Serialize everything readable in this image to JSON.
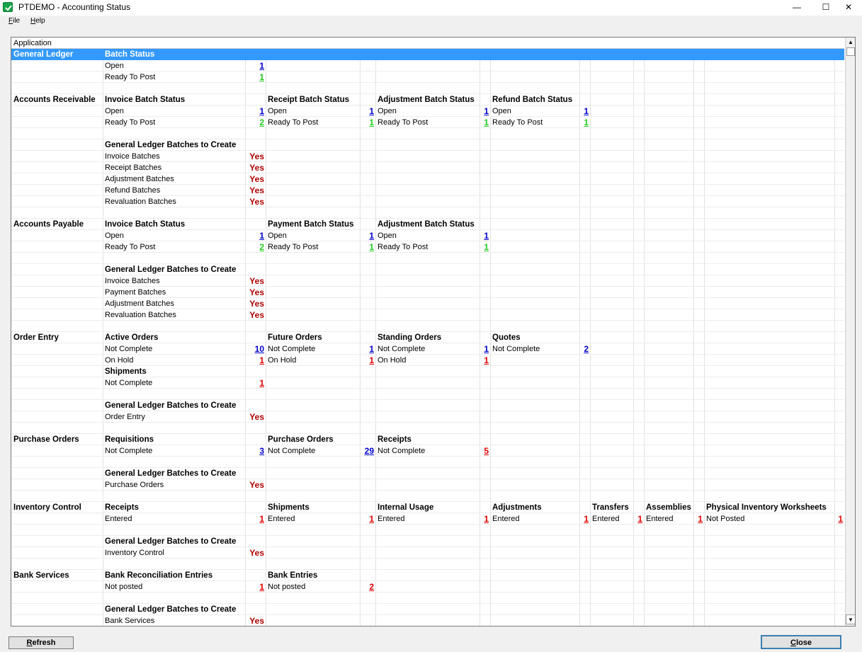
{
  "window": {
    "title": "PTDEMO - Accounting Status",
    "min": "—",
    "max": "☐",
    "close": "✕"
  },
  "menu": [
    {
      "first": "F",
      "rest": "ile"
    },
    {
      "first": "H",
      "rest": "elp"
    }
  ],
  "header": {
    "application": "Application"
  },
  "buttons": {
    "refresh_first": "R",
    "refresh_rest": "efresh",
    "close_first": "C",
    "close_rest": "lose"
  },
  "colors": {
    "selected": "#3399ff",
    "open": "#0000cc",
    "ready": "#22cc22",
    "alert": "#e00000",
    "yes": "#b00000"
  },
  "rows": [
    [
      {
        "c": 0,
        "t": "General Ledger",
        "k": "app"
      },
      {
        "c": 1,
        "t": "Batch Status",
        "k": "hdr"
      }
    ],
    [
      {
        "c": 1,
        "t": "Open",
        "k": "lbl"
      },
      {
        "c": 2,
        "t": "1",
        "k": "num",
        "col": "blue"
      }
    ],
    [
      {
        "c": 1,
        "t": "Ready To Post",
        "k": "lbl"
      },
      {
        "c": 2,
        "t": "1",
        "k": "num",
        "col": "green"
      }
    ],
    [],
    [
      {
        "c": 0,
        "t": "Accounts Receivable",
        "k": "app"
      },
      {
        "c": 1,
        "t": "Invoice Batch Status",
        "k": "hdr"
      },
      {
        "c": 3,
        "t": "Receipt Batch Status",
        "k": "hdr"
      },
      {
        "c": 5,
        "t": "Adjustment Batch Status",
        "k": "hdr"
      },
      {
        "c": 7,
        "t": "Refund Batch Status",
        "k": "hdr"
      }
    ],
    [
      {
        "c": 1,
        "t": "Open",
        "k": "lbl"
      },
      {
        "c": 2,
        "t": "1",
        "k": "num",
        "col": "blue"
      },
      {
        "c": 3,
        "t": "Open",
        "k": "lbl"
      },
      {
        "c": 4,
        "t": "1",
        "k": "num",
        "col": "blue"
      },
      {
        "c": 5,
        "t": "Open",
        "k": "lbl"
      },
      {
        "c": 6,
        "t": "1",
        "k": "num",
        "col": "blue"
      },
      {
        "c": 7,
        "t": "Open",
        "k": "lbl"
      },
      {
        "c": 8,
        "t": "1",
        "k": "num",
        "col": "blue"
      }
    ],
    [
      {
        "c": 1,
        "t": "Ready To Post",
        "k": "lbl"
      },
      {
        "c": 2,
        "t": "2",
        "k": "num",
        "col": "green"
      },
      {
        "c": 3,
        "t": "Ready To Post",
        "k": "lbl"
      },
      {
        "c": 4,
        "t": "1",
        "k": "num",
        "col": "green"
      },
      {
        "c": 5,
        "t": "Ready To Post",
        "k": "lbl"
      },
      {
        "c": 6,
        "t": "1",
        "k": "num",
        "col": "green"
      },
      {
        "c": 7,
        "t": "Ready To Post",
        "k": "lbl"
      },
      {
        "c": 8,
        "t": "1",
        "k": "num",
        "col": "green"
      }
    ],
    [],
    [
      {
        "c": 1,
        "t": "General Ledger Batches to Create",
        "k": "hdr"
      }
    ],
    [
      {
        "c": 1,
        "t": "Invoice Batches",
        "k": "lbl"
      },
      {
        "c": 2,
        "t": "Yes",
        "k": "yes",
        "col": "darkred"
      }
    ],
    [
      {
        "c": 1,
        "t": "Receipt Batches",
        "k": "lbl"
      },
      {
        "c": 2,
        "t": "Yes",
        "k": "yes",
        "col": "darkred"
      }
    ],
    [
      {
        "c": 1,
        "t": "Adjustment Batches",
        "k": "lbl"
      },
      {
        "c": 2,
        "t": "Yes",
        "k": "yes",
        "col": "darkred"
      }
    ],
    [
      {
        "c": 1,
        "t": "Refund Batches",
        "k": "lbl"
      },
      {
        "c": 2,
        "t": "Yes",
        "k": "yes",
        "col": "darkred"
      }
    ],
    [
      {
        "c": 1,
        "t": "Revaluation Batches",
        "k": "lbl"
      },
      {
        "c": 2,
        "t": "Yes",
        "k": "yes",
        "col": "darkred"
      }
    ],
    [],
    [
      {
        "c": 0,
        "t": "Accounts Payable",
        "k": "app"
      },
      {
        "c": 1,
        "t": "Invoice Batch Status",
        "k": "hdr"
      },
      {
        "c": 3,
        "t": "Payment Batch Status",
        "k": "hdr"
      },
      {
        "c": 5,
        "t": "Adjustment Batch Status",
        "k": "hdr"
      }
    ],
    [
      {
        "c": 1,
        "t": "Open",
        "k": "lbl"
      },
      {
        "c": 2,
        "t": "1",
        "k": "num",
        "col": "blue"
      },
      {
        "c": 3,
        "t": "Open",
        "k": "lbl"
      },
      {
        "c": 4,
        "t": "1",
        "k": "num",
        "col": "blue"
      },
      {
        "c": 5,
        "t": "Open",
        "k": "lbl"
      },
      {
        "c": 6,
        "t": "1",
        "k": "num",
        "col": "blue"
      }
    ],
    [
      {
        "c": 1,
        "t": "Ready To Post",
        "k": "lbl"
      },
      {
        "c": 2,
        "t": "2",
        "k": "num",
        "col": "green"
      },
      {
        "c": 3,
        "t": "Ready To Post",
        "k": "lbl"
      },
      {
        "c": 4,
        "t": "1",
        "k": "num",
        "col": "green"
      },
      {
        "c": 5,
        "t": "Ready To Post",
        "k": "lbl"
      },
      {
        "c": 6,
        "t": "1",
        "k": "num",
        "col": "green"
      }
    ],
    [],
    [
      {
        "c": 1,
        "t": "General Ledger Batches to Create",
        "k": "hdr"
      }
    ],
    [
      {
        "c": 1,
        "t": "Invoice Batches",
        "k": "lbl"
      },
      {
        "c": 2,
        "t": "Yes",
        "k": "yes",
        "col": "darkred"
      }
    ],
    [
      {
        "c": 1,
        "t": "Payment Batches",
        "k": "lbl"
      },
      {
        "c": 2,
        "t": "Yes",
        "k": "yes",
        "col": "darkred"
      }
    ],
    [
      {
        "c": 1,
        "t": "Adjustment Batches",
        "k": "lbl"
      },
      {
        "c": 2,
        "t": "Yes",
        "k": "yes",
        "col": "darkred"
      }
    ],
    [
      {
        "c": 1,
        "t": "Revaluation Batches",
        "k": "lbl"
      },
      {
        "c": 2,
        "t": "Yes",
        "k": "yes",
        "col": "darkred"
      }
    ],
    [],
    [
      {
        "c": 0,
        "t": "Order Entry",
        "k": "app"
      },
      {
        "c": 1,
        "t": "Active Orders",
        "k": "hdr"
      },
      {
        "c": 3,
        "t": "Future Orders",
        "k": "hdr"
      },
      {
        "c": 5,
        "t": "Standing Orders",
        "k": "hdr"
      },
      {
        "c": 7,
        "t": "Quotes",
        "k": "hdr"
      }
    ],
    [
      {
        "c": 1,
        "t": "Not Complete",
        "k": "lbl"
      },
      {
        "c": 2,
        "t": "10",
        "k": "num",
        "col": "blue"
      },
      {
        "c": 3,
        "t": "Not Complete",
        "k": "lbl"
      },
      {
        "c": 4,
        "t": "1",
        "k": "num",
        "col": "blue"
      },
      {
        "c": 5,
        "t": "Not Complete",
        "k": "lbl"
      },
      {
        "c": 6,
        "t": "1",
        "k": "num",
        "col": "blue"
      },
      {
        "c": 7,
        "t": "Not Complete",
        "k": "lbl"
      },
      {
        "c": 8,
        "t": "2",
        "k": "num",
        "col": "blue"
      }
    ],
    [
      {
        "c": 1,
        "t": "On Hold",
        "k": "lbl"
      },
      {
        "c": 2,
        "t": "1",
        "k": "num",
        "col": "red"
      },
      {
        "c": 3,
        "t": "On Hold",
        "k": "lbl"
      },
      {
        "c": 4,
        "t": "1",
        "k": "num",
        "col": "red"
      },
      {
        "c": 5,
        "t": "On Hold",
        "k": "lbl"
      },
      {
        "c": 6,
        "t": "1",
        "k": "num",
        "col": "red"
      }
    ],
    [
      {
        "c": 1,
        "t": "Shipments",
        "k": "hdr"
      }
    ],
    [
      {
        "c": 1,
        "t": "Not Complete",
        "k": "lbl"
      },
      {
        "c": 2,
        "t": "1",
        "k": "num",
        "col": "red"
      }
    ],
    [],
    [
      {
        "c": 1,
        "t": "General Ledger Batches to Create",
        "k": "hdr"
      }
    ],
    [
      {
        "c": 1,
        "t": "Order Entry",
        "k": "lbl"
      },
      {
        "c": 2,
        "t": "Yes",
        "k": "yes",
        "col": "darkred"
      }
    ],
    [],
    [
      {
        "c": 0,
        "t": "Purchase Orders",
        "k": "app"
      },
      {
        "c": 1,
        "t": "Requisitions",
        "k": "hdr"
      },
      {
        "c": 3,
        "t": "Purchase Orders",
        "k": "hdr"
      },
      {
        "c": 5,
        "t": "Receipts",
        "k": "hdr"
      }
    ],
    [
      {
        "c": 1,
        "t": "Not Complete",
        "k": "lbl"
      },
      {
        "c": 2,
        "t": "3",
        "k": "num",
        "col": "blue"
      },
      {
        "c": 3,
        "t": "Not Complete",
        "k": "lbl"
      },
      {
        "c": 4,
        "t": "29",
        "k": "num",
        "col": "blue"
      },
      {
        "c": 5,
        "t": "Not Complete",
        "k": "lbl"
      },
      {
        "c": 6,
        "t": "5",
        "k": "num",
        "col": "red"
      }
    ],
    [],
    [
      {
        "c": 1,
        "t": "General Ledger Batches to Create",
        "k": "hdr"
      }
    ],
    [
      {
        "c": 1,
        "t": "Purchase Orders",
        "k": "lbl"
      },
      {
        "c": 2,
        "t": "Yes",
        "k": "yes",
        "col": "darkred"
      }
    ],
    [],
    [
      {
        "c": 0,
        "t": "Inventory Control",
        "k": "app"
      },
      {
        "c": 1,
        "t": "Receipts",
        "k": "hdr"
      },
      {
        "c": 3,
        "t": "Shipments",
        "k": "hdr"
      },
      {
        "c": 5,
        "t": "Internal Usage",
        "k": "hdr"
      },
      {
        "c": 7,
        "t": "Adjustments",
        "k": "hdr"
      },
      {
        "c": 9,
        "t": "Transfers",
        "k": "hdr"
      },
      {
        "c": 11,
        "t": "Assemblies",
        "k": "hdr"
      },
      {
        "c": 13,
        "t": "Physical Inventory Worksheets",
        "k": "hdr"
      }
    ],
    [
      {
        "c": 1,
        "t": "Entered",
        "k": "lbl"
      },
      {
        "c": 2,
        "t": "1",
        "k": "num",
        "col": "red"
      },
      {
        "c": 3,
        "t": "Entered",
        "k": "lbl"
      },
      {
        "c": 4,
        "t": "1",
        "k": "num",
        "col": "red"
      },
      {
        "c": 5,
        "t": "Entered",
        "k": "lbl"
      },
      {
        "c": 6,
        "t": "1",
        "k": "num",
        "col": "red"
      },
      {
        "c": 7,
        "t": "Entered",
        "k": "lbl"
      },
      {
        "c": 8,
        "t": "1",
        "k": "num",
        "col": "red"
      },
      {
        "c": 9,
        "t": "Entered",
        "k": "lbl"
      },
      {
        "c": 10,
        "t": "1",
        "k": "num",
        "col": "red"
      },
      {
        "c": 11,
        "t": "Entered",
        "k": "lbl"
      },
      {
        "c": 12,
        "t": "1",
        "k": "num",
        "col": "red"
      },
      {
        "c": 13,
        "t": "Not Posted",
        "k": "lbl"
      },
      {
        "c": 14,
        "t": "1",
        "k": "num",
        "col": "red"
      }
    ],
    [],
    [
      {
        "c": 1,
        "t": "General Ledger Batches to Create",
        "k": "hdr"
      }
    ],
    [
      {
        "c": 1,
        "t": "Inventory Control",
        "k": "lbl"
      },
      {
        "c": 2,
        "t": "Yes",
        "k": "yes",
        "col": "darkred"
      }
    ],
    [],
    [
      {
        "c": 0,
        "t": "Bank Services",
        "k": "app"
      },
      {
        "c": 1,
        "t": "Bank Reconciliation Entries",
        "k": "hdr"
      },
      {
        "c": 3,
        "t": "Bank Entries",
        "k": "hdr"
      }
    ],
    [
      {
        "c": 1,
        "t": "Not posted",
        "k": "lbl"
      },
      {
        "c": 2,
        "t": "1",
        "k": "num",
        "col": "red"
      },
      {
        "c": 3,
        "t": "Not posted",
        "k": "lbl"
      },
      {
        "c": 4,
        "t": "2",
        "k": "num",
        "col": "red"
      }
    ],
    [],
    [
      {
        "c": 1,
        "t": "General Ledger Batches to Create",
        "k": "hdr"
      }
    ],
    [
      {
        "c": 1,
        "t": "Bank Services",
        "k": "lbl"
      },
      {
        "c": 2,
        "t": "Yes",
        "k": "yes",
        "col": "darkred"
      }
    ]
  ]
}
